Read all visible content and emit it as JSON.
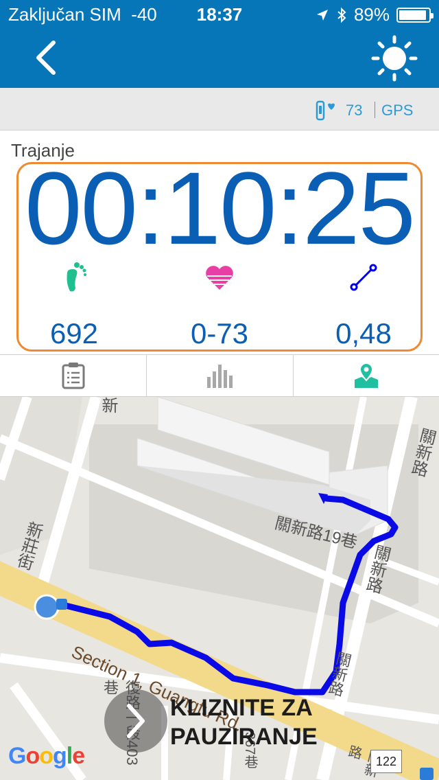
{
  "status_bar": {
    "carrier": "Zaključan SIM",
    "signal": "-40",
    "time": "18:37",
    "battery": "89%",
    "battery_level": 0.89,
    "icons": [
      "location-arrow-icon",
      "bluetooth-icon",
      "battery-icon"
    ]
  },
  "nav": {
    "back_icon": "chevron-left-icon",
    "brightness_icon": "sun-icon"
  },
  "sub_bar": {
    "device_icon": "watch-heart-icon",
    "heart_rate": "73",
    "gps_label": "GPS"
  },
  "workout": {
    "duration_label": "Trajanje",
    "duration": "00:10:25",
    "steps": "692",
    "heart_rate_range": "0-73",
    "distance": "0,48",
    "stat_icons": [
      "footprint-icon",
      "heart-icon",
      "route-icon"
    ]
  },
  "tabs": [
    {
      "icon": "clipboard-icon",
      "active": false
    },
    {
      "icon": "bar-chart-icon",
      "active": false
    },
    {
      "icon": "map-pin-icon",
      "active": true
    }
  ],
  "map": {
    "street_labels": [
      "新",
      "新莊街",
      "關新路",
      "關新路19巷",
      "關新路",
      "Section 1, Guangfu Rd.",
      "復路一段403巷",
      "367巷",
      "關新路",
      "關新路"
    ],
    "road_number": "122",
    "attribution": "Google"
  },
  "slider": {
    "line1": "KLIZNITE ZA",
    "line2": "PAUZIRANJE"
  },
  "colors": {
    "primary": "#0776b8",
    "timer_blue": "#0a5fb4",
    "highlight_orange": "#f08a30",
    "steps_green": "#1fbf8f",
    "heart_pink": "#e83fa4",
    "route_blue": "#0000ee"
  }
}
